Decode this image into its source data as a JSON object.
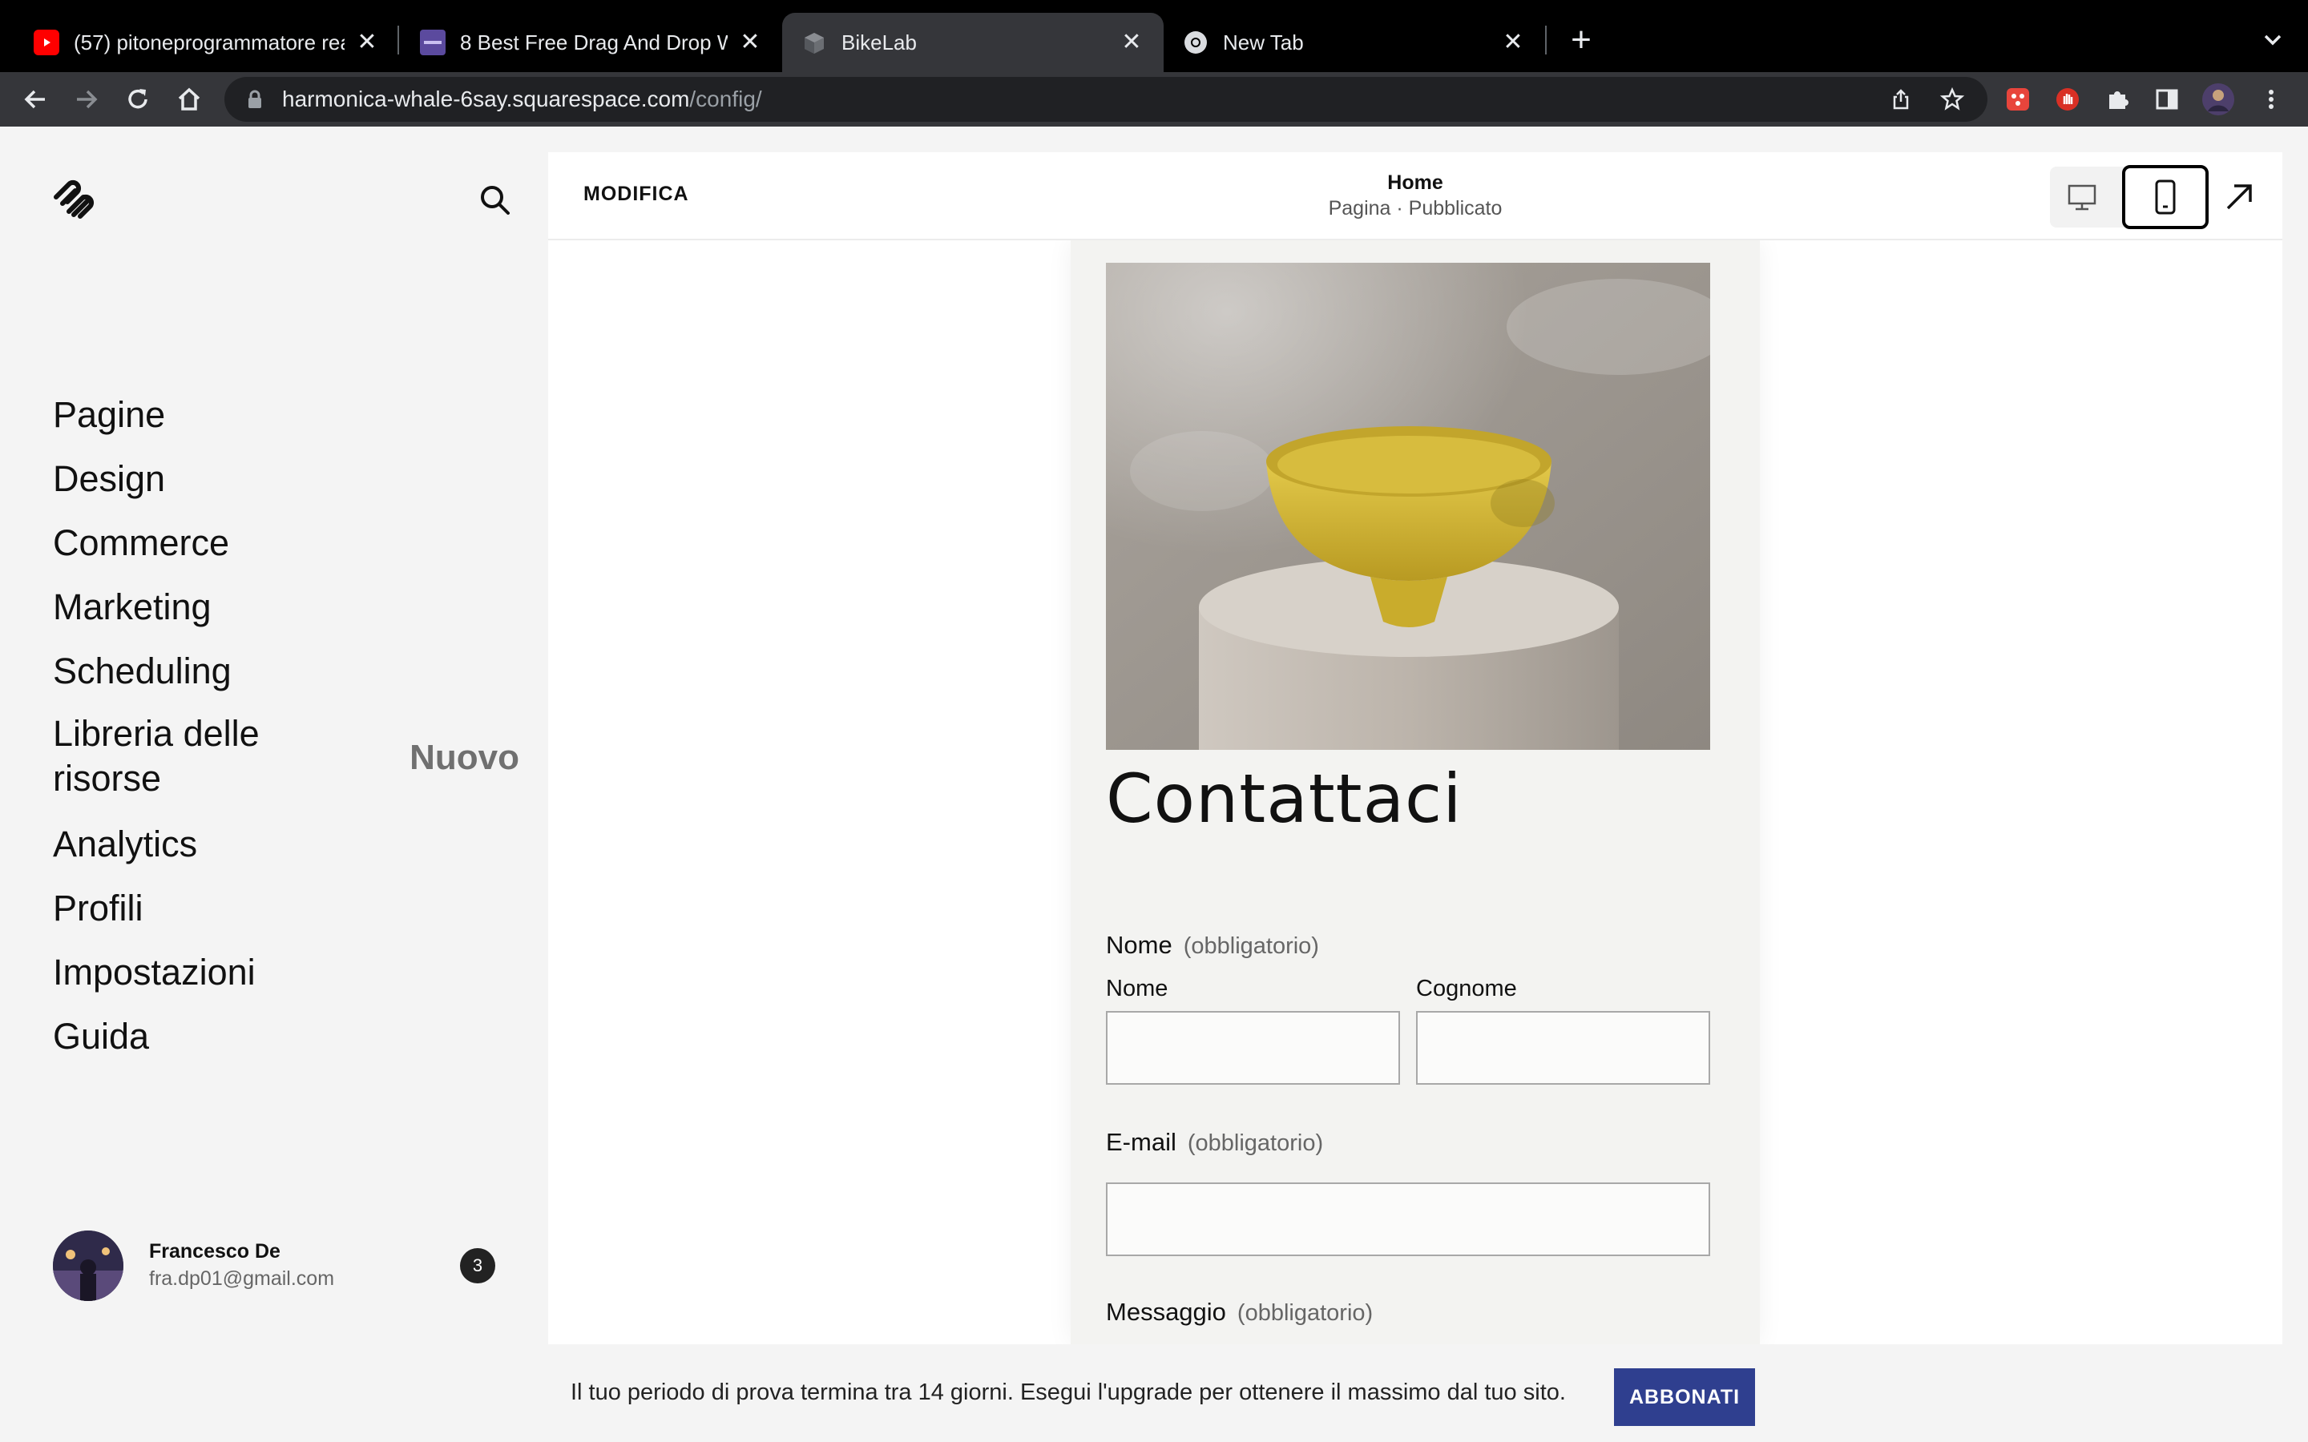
{
  "browser": {
    "tabs": [
      {
        "title": "(57) pitoneprogrammatore rea",
        "favicon": "youtube-icon"
      },
      {
        "title": "8 Best Free Drag And Drop We",
        "favicon": "colorlib-icon"
      },
      {
        "title": "BikeLab",
        "favicon": "cube-icon",
        "active": true
      },
      {
        "title": "New Tab",
        "favicon": "chrome-icon"
      }
    ],
    "url_host": "harmonica-whale-6say.squarespace.com",
    "url_path": "/config/"
  },
  "sidebar": {
    "nav": [
      {
        "label": "Pagine"
      },
      {
        "label": "Design"
      },
      {
        "label": "Commerce"
      },
      {
        "label": "Marketing"
      },
      {
        "label": "Scheduling"
      },
      {
        "label": "Libreria delle risorse",
        "badge": "Nuovo"
      },
      {
        "label": "Analytics"
      },
      {
        "label": "Profili"
      },
      {
        "label": "Impostazioni"
      },
      {
        "label": "Guida"
      }
    ],
    "user": {
      "name": "Francesco De",
      "email": "fra.dp01@gmail.com",
      "notifications": "3"
    }
  },
  "editor": {
    "edit_label": "MODIFICA",
    "page_title": "Home",
    "page_status": "Pagina · Pubblicato"
  },
  "preview": {
    "heading": "Contattaci",
    "name_label": "Nome",
    "required": "(obbligatorio)",
    "first_name_label": "Nome",
    "last_name_label": "Cognome",
    "email_label": "E-mail",
    "message_label": "Messaggio"
  },
  "trial": {
    "text": "Il tuo periodo di prova termina tra 14 giorni. Esegui l'upgrade per ottenere il massimo dal tuo sito.",
    "button": "ABBONATI"
  },
  "colors": {
    "subscribe_button": "#2f3f8f",
    "bowl": "#d4b83a"
  }
}
